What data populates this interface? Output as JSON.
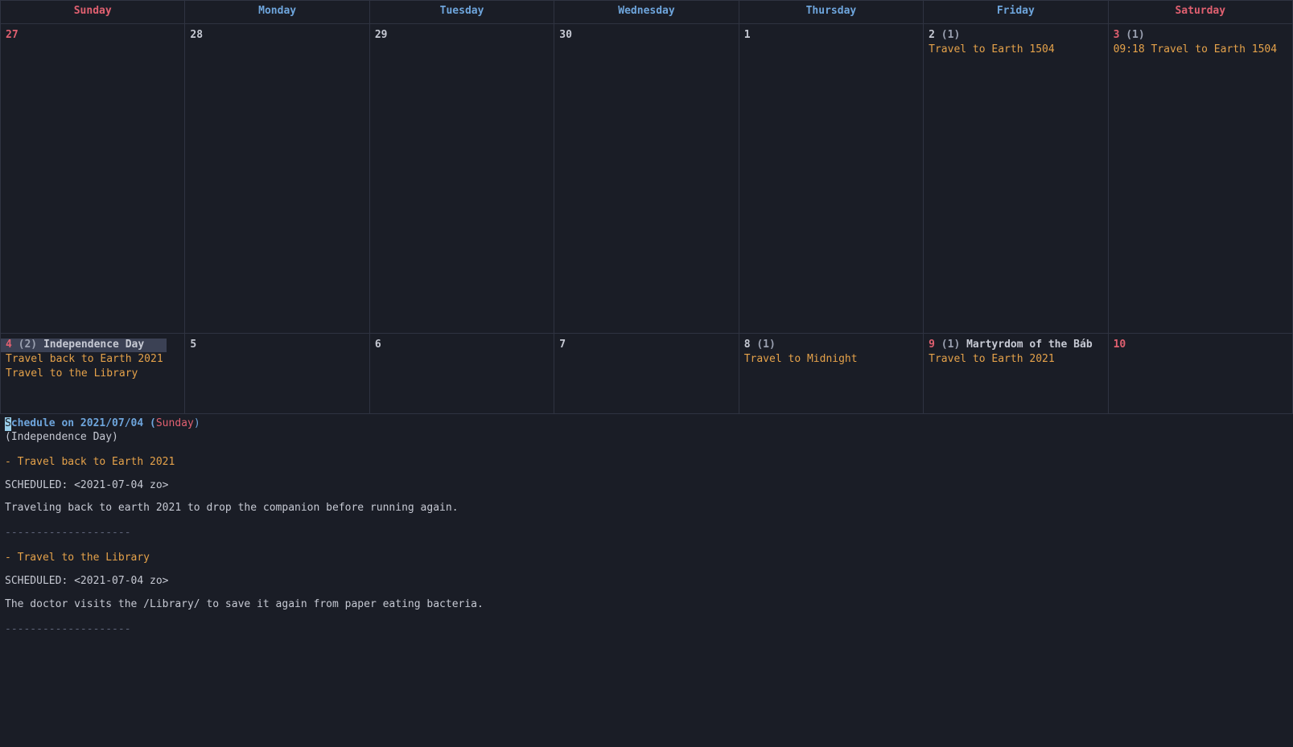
{
  "days_of_week": {
    "sun": "Sunday",
    "mon": "Monday",
    "tue": "Tuesday",
    "wed": "Wednesday",
    "thu": "Thursday",
    "fri": "Friday",
    "sat": "Saturday"
  },
  "week1": {
    "sun": {
      "num": "27"
    },
    "mon": {
      "num": "28"
    },
    "tue": {
      "num": "29"
    },
    "wed": {
      "num": "30"
    },
    "thu": {
      "num": "1"
    },
    "fri": {
      "num": "2",
      "count": "(1)",
      "events": [
        "Travel to Earth 1504"
      ]
    },
    "sat": {
      "num": "3",
      "count": "(1)",
      "events": [
        "09:18 Travel to Earth 1504"
      ]
    }
  },
  "week2": {
    "sun": {
      "num": "4",
      "count": "(2)",
      "holiday": "Independence Day",
      "events": [
        "Travel back to Earth 2021",
        "Travel to the Library"
      ]
    },
    "mon": {
      "num": "5"
    },
    "tue": {
      "num": "6"
    },
    "wed": {
      "num": "7"
    },
    "thu": {
      "num": "8",
      "count": "(1)",
      "events": [
        "Travel to Midnight"
      ]
    },
    "fri": {
      "num": "9",
      "count": "(1)",
      "holiday": "Martyrdom of the Báb",
      "events": [
        "Travel to Earth 2021"
      ]
    },
    "sat": {
      "num": "10"
    }
  },
  "schedule": {
    "title_prefix_char": "S",
    "title_rest": "chedule on 2021/07/04 (",
    "title_day": "Sunday",
    "title_close": ")",
    "subtitle": "(Independence Day)",
    "item1_head": "- Travel back to Earth 2021",
    "item1_sched": "   SCHEDULED: <2021-07-04 zo>",
    "item1_body": "   Traveling back to earth 2021 to drop the companion before running again.",
    "rule": "--------------------",
    "item2_head": "- Travel to the Library",
    "item2_sched": "   SCHEDULED: <2021-07-04 zo>",
    "item2_body": "   The doctor visits the /Library/ to save it again from paper eating bacteria."
  }
}
